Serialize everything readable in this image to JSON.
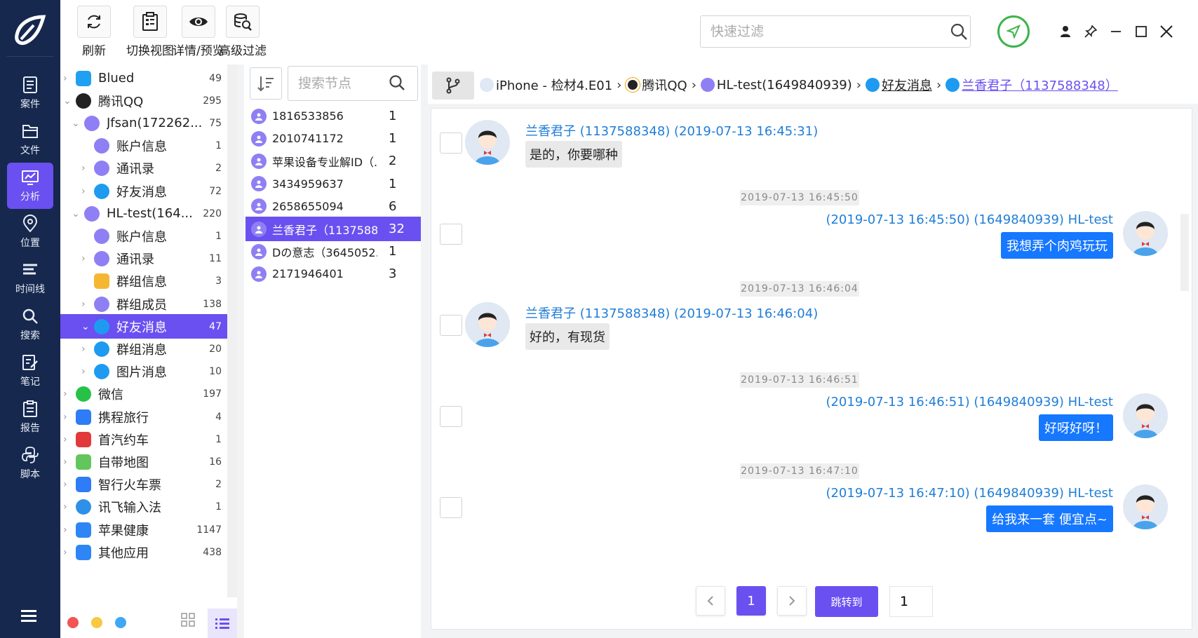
{
  "nav": {
    "items": [
      {
        "label": "案件",
        "icon": "case-icon"
      },
      {
        "label": "文件",
        "icon": "folder-icon"
      },
      {
        "label": "分析",
        "icon": "analysis-icon"
      },
      {
        "label": "位置",
        "icon": "location-icon"
      },
      {
        "label": "时间线",
        "icon": "timeline-icon"
      },
      {
        "label": "搜索",
        "icon": "search-icon"
      },
      {
        "label": "笔记",
        "icon": "note-icon"
      },
      {
        "label": "报告",
        "icon": "report-icon"
      },
      {
        "label": "脚本",
        "icon": "python-icon"
      }
    ],
    "active_index": 2
  },
  "toolbar": {
    "refresh": "刷新",
    "switch_view": "切换视图",
    "detail_preview": "详情/预览",
    "advanced_filter": "高级过滤",
    "quick_filter_placeholder": "快速过滤"
  },
  "tree": {
    "rows": [
      {
        "label": "Blued",
        "count": "49",
        "icon": "blued-icon"
      },
      {
        "label": "腾讯QQ",
        "count": "295",
        "icon": "qq-icon"
      },
      {
        "label": "Jfsan(172262...",
        "count": "75",
        "icon": "user-icon"
      },
      {
        "label": "账户信息",
        "count": "1",
        "icon": "user-icon"
      },
      {
        "label": "通讯录",
        "count": "2",
        "icon": "user-icon"
      },
      {
        "label": "好友消息",
        "count": "72",
        "icon": "chat-bubble-icon"
      },
      {
        "label": "HL-test(164...",
        "count": "220",
        "icon": "user-icon"
      },
      {
        "label": "账户信息",
        "count": "1",
        "icon": "user-icon"
      },
      {
        "label": "通讯录",
        "count": "11",
        "icon": "user-icon"
      },
      {
        "label": "群组信息",
        "count": "3",
        "icon": "group-info-icon"
      },
      {
        "label": "群组成员",
        "count": "138",
        "icon": "user-icon"
      },
      {
        "label": "好友消息",
        "count": "47",
        "icon": "chat-bubble-icon"
      },
      {
        "label": "群组消息",
        "count": "20",
        "icon": "chat-bubble-icon"
      },
      {
        "label": "图片消息",
        "count": "10",
        "icon": "chat-bubble-icon"
      },
      {
        "label": "微信",
        "count": "197",
        "icon": "wechat-icon"
      },
      {
        "label": "携程旅行",
        "count": "4",
        "icon": "ctrip-icon"
      },
      {
        "label": "首汽约车",
        "count": "1",
        "icon": "car-icon"
      },
      {
        "label": "自带地图",
        "count": "16",
        "icon": "maps-icon"
      },
      {
        "label": "智行火车票",
        "count": "2",
        "icon": "train-icon"
      },
      {
        "label": "讯飞输入法",
        "count": "1",
        "icon": "ifly-icon"
      },
      {
        "label": "苹果健康",
        "count": "1147",
        "icon": "appstore-icon"
      },
      {
        "label": "其他应用",
        "count": "438",
        "icon": "appstore-icon"
      }
    ],
    "selected_index": 11
  },
  "contacts": {
    "search_placeholder": "搜索节点",
    "rows": [
      {
        "name": "1816533856",
        "count": "1"
      },
      {
        "name": "2010741172",
        "count": "1"
      },
      {
        "name": "苹果设备专业解ID（...",
        "count": "2"
      },
      {
        "name": "3434959637",
        "count": "1"
      },
      {
        "name": "2658655094",
        "count": "6"
      },
      {
        "name": "兰香君子（1137588...",
        "count": "32"
      },
      {
        "name": "Dの意志（3645052...",
        "count": "1"
      },
      {
        "name": "2171946401",
        "count": "3"
      }
    ],
    "selected_index": 5
  },
  "breadcrumb": {
    "device": "iPhone - 检材4.E01",
    "app": "腾讯QQ",
    "account": "HL-test(1649840939)",
    "category": "好友消息",
    "contact": "兰香君子（1137588348）"
  },
  "messages": [
    {
      "dir": "in",
      "header": "兰香君子 (1137588348) (2019-07-13 16:45:31)",
      "text": "是的，你要哪种"
    },
    {
      "dir": "out",
      "time": "2019-07-13 16:45:50",
      "header": "(2019-07-13 16:45:50) (1649840939) HL-test",
      "text": "我想弄个肉鸡玩玩"
    },
    {
      "dir": "in",
      "time": "2019-07-13 16:46:04",
      "header": "兰香君子 (1137588348) (2019-07-13 16:46:04)",
      "text": "好的，有现货"
    },
    {
      "dir": "out",
      "time": "2019-07-13 16:46:51",
      "header": "(2019-07-13 16:46:51) (1649840939) HL-test",
      "text": "好呀好呀！"
    },
    {
      "dir": "out",
      "time": "2019-07-13 16:47:10",
      "header": "(2019-07-13 16:47:10) (1649840939) HL-test",
      "text": "给我来一套 便宜点~"
    }
  ],
  "pager": {
    "current_page": "1",
    "jump_label": "跳转到",
    "jump_value": "1"
  },
  "colors": {
    "nav_bg": "#16284d",
    "accent": "#6a50f0",
    "link_blue": "#1f7ed8",
    "bubble_out": "#1677ff"
  }
}
